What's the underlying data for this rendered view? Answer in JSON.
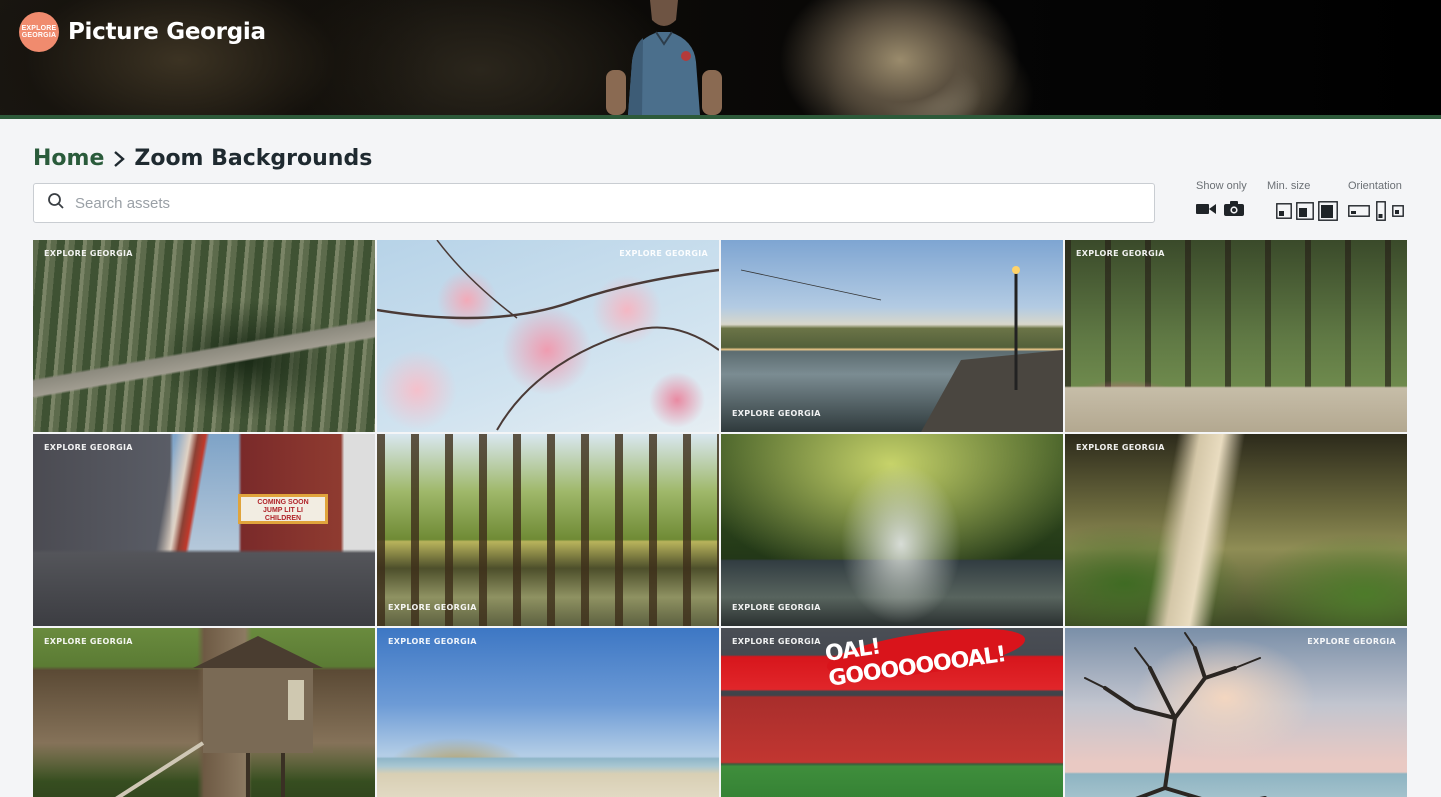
{
  "header": {
    "brand_title": "Picture Georgia",
    "logo_text_line1": "EXPLORE",
    "logo_text_line2": "GEORGIA"
  },
  "breadcrumb": {
    "home_label": "Home",
    "current_label": "Zoom Backgrounds"
  },
  "search": {
    "placeholder": "Search assets",
    "value": ""
  },
  "filters": {
    "show_only_label": "Show only",
    "min_size_label": "Min. size",
    "orientation_label": "Orientation",
    "show_only_icons": [
      "video-icon",
      "camera-icon"
    ],
    "min_size_icons": [
      "small-size-icon",
      "medium-size-icon",
      "large-size-icon"
    ],
    "orientation_icons": [
      "landscape-icon",
      "portrait-icon",
      "square-icon"
    ]
  },
  "tiles": [
    {
      "watermark": "EXPLORE GEORGIA",
      "watermark_pos": "tl",
      "scene": "swamp-boardwalk"
    },
    {
      "watermark": "EXPLORE GEORGIA",
      "watermark_pos": "tr",
      "scene": "cherry-blossoms"
    },
    {
      "watermark": "EXPLORE GEORGIA",
      "watermark_pos": "bl",
      "scene": "riverfront-zipline"
    },
    {
      "watermark": "EXPLORE GEORGIA",
      "watermark_pos": "tl",
      "scene": "oak-avenue-park"
    },
    {
      "watermark": "EXPLORE GEORGIA",
      "watermark_pos": "tl",
      "scene": "theatre-street"
    },
    {
      "watermark": "EXPLORE GEORGIA",
      "watermark_pos": "bl",
      "scene": "cypress-lake"
    },
    {
      "watermark": "EXPLORE GEORGIA",
      "watermark_pos": "bl",
      "scene": "forest-waterfall"
    },
    {
      "watermark": "EXPLORE GEORGIA",
      "watermark_pos": "tl",
      "scene": "live-oak-trail"
    },
    {
      "watermark": "EXPLORE GEORGIA",
      "watermark_pos": "tl",
      "scene": "treehouse"
    },
    {
      "watermark": "EXPLORE GEORGIA",
      "watermark_pos": "tl",
      "scene": "beach-dunes"
    },
    {
      "watermark": "EXPLORE GEORGIA",
      "watermark_pos": "tl",
      "scene": "stadium"
    },
    {
      "watermark": "EXPLORE GEORGIA",
      "watermark_pos": "tr",
      "scene": "driftwood-beach"
    }
  ],
  "theater_marquee": {
    "line1": "COMING SOON",
    "line2": "JUMP LIT LI",
    "line3": "CHILDREN"
  },
  "stadium_banner": "OAL! GOOOOOOOAL!",
  "colors": {
    "brand_green": "#2a5b3b",
    "logo_orange": "#f08b6e",
    "header_border": "#2d5a3a"
  }
}
